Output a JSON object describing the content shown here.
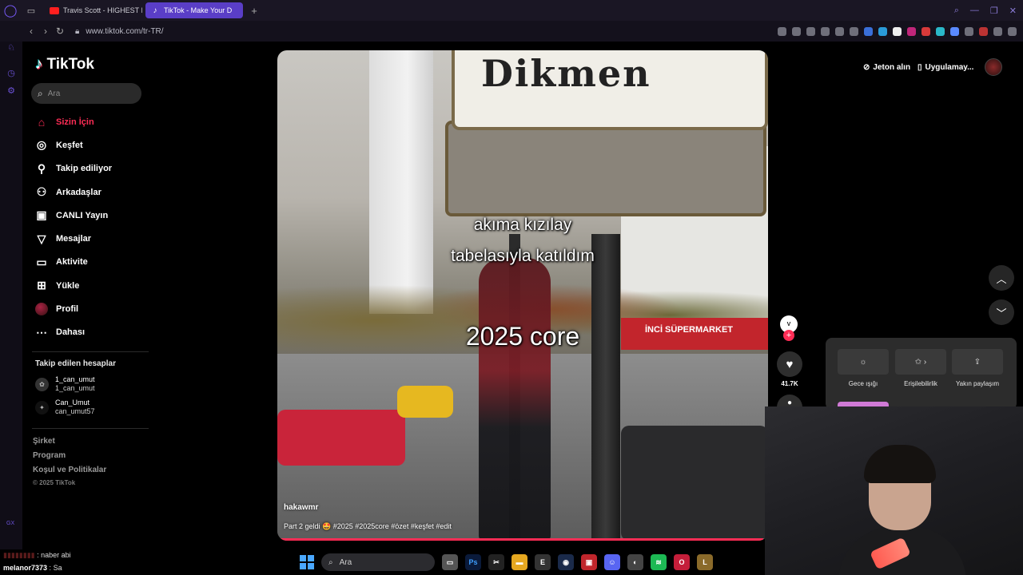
{
  "browser": {
    "tabs": [
      {
        "label": "Travis Scott - HIGHEST IN",
        "active": false
      },
      {
        "label": "TikTok - Make Your D",
        "active": true
      }
    ],
    "url": "www.tiktok.com/tr-TR/"
  },
  "sidebar": {
    "brand": "TikTok",
    "search_placeholder": "Ara",
    "nav": [
      {
        "label": "Sizin İçin",
        "icon": "home-icon",
        "active": true
      },
      {
        "label": "Keşfet",
        "icon": "compass-icon",
        "active": false
      },
      {
        "label": "Takip ediliyor",
        "icon": "user-follow-icon",
        "active": false
      },
      {
        "label": "Arkadaşlar",
        "icon": "friends-icon",
        "active": false
      },
      {
        "label": "CANLI Yayın",
        "icon": "live-tv-icon",
        "active": false
      },
      {
        "label": "Mesajlar",
        "icon": "send-icon",
        "active": false
      },
      {
        "label": "Aktivite",
        "icon": "activity-icon",
        "active": false
      },
      {
        "label": "Yükle",
        "icon": "upload-icon",
        "active": false
      },
      {
        "label": "Profil",
        "icon": "profile-avatar",
        "active": false
      },
      {
        "label": "Dahası",
        "icon": "more-icon",
        "active": false
      }
    ],
    "following_title": "Takip edilen hesaplar",
    "following": [
      {
        "name": "1_can_umut",
        "username": "1_can_umut"
      },
      {
        "name": "Can_Umut",
        "username": "can_umut57"
      }
    ],
    "footer": [
      "Şirket",
      "Program",
      "Koşul ve Politikalar"
    ],
    "copyright": "© 2025 TikTok"
  },
  "video": {
    "captions": [
      "akıma kızılay",
      "tabelasıyla katıldım",
      "2025 core"
    ],
    "sign_text": "Dikmen",
    "shop_text": "İNCİ SÜPERMARKET",
    "author": "hakawmr",
    "description": "Part 2 geldi 🤩 #2025 #2025core #özet #keşfet #edit",
    "progress": 0.99
  },
  "actions": {
    "like_count": "41.7K",
    "avatar_text": "V"
  },
  "topright": {
    "coins": "Jeton alın",
    "app": "Uygulamay..."
  },
  "menu": {
    "items": [
      "Gece ışığı",
      "Erişilebilirlik",
      "Yakın paylaşım"
    ]
  },
  "chat": [
    {
      "user": "naber abi",
      "msg": ""
    },
    {
      "user": "melanor7373",
      "msg": "Sa"
    }
  ],
  "taskbar": {
    "search_label": "Ara"
  },
  "colors": {
    "tiktok_red": "#fe2c55",
    "opera_purple": "#5a3ec7"
  }
}
